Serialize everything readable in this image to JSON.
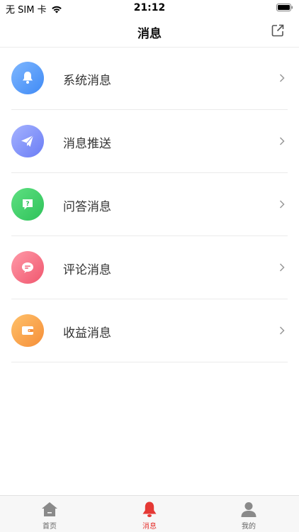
{
  "status": {
    "carrier": "无 SIM 卡",
    "time": "21:12"
  },
  "nav": {
    "title": "消息"
  },
  "items": [
    {
      "label": "系统消息",
      "icon": "bell-icon",
      "color": "#4f95f7"
    },
    {
      "label": "消息推送",
      "icon": "paper-plane-icon",
      "color": "#7a8af7"
    },
    {
      "label": "问答消息",
      "icon": "question-icon",
      "color": "#3ccb65"
    },
    {
      "label": "评论消息",
      "icon": "comment-icon",
      "color": "#f3647a"
    },
    {
      "label": "收益消息",
      "icon": "wallet-icon",
      "color": "#f79a43"
    }
  ],
  "tabs": [
    {
      "label": "首页",
      "icon": "home-icon",
      "active": false
    },
    {
      "label": "消息",
      "icon": "bell-icon",
      "active": true
    },
    {
      "label": "我的",
      "icon": "user-icon",
      "active": false
    }
  ],
  "colors": {
    "accent": "#e53935"
  }
}
